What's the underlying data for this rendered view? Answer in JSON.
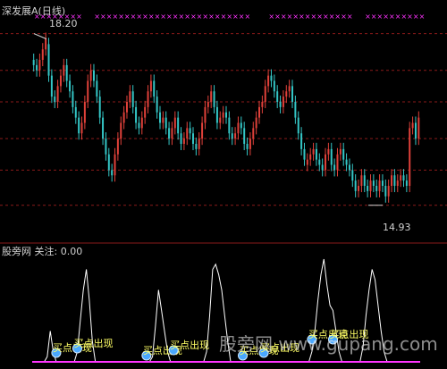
{
  "top_panel": {
    "title": "深发展A(日线)",
    "high_label": "18.20",
    "low_label": "14.93"
  },
  "bottom_panel": {
    "title": "股旁网 关注: 0.00",
    "signals": [
      {
        "label": "买点出现",
        "ref": 0
      },
      {
        "label": "买点出现",
        "ref": 1
      },
      {
        "label": "买点出现",
        "ref": 2
      },
      {
        "label": "买点出现",
        "ref": 3
      },
      {
        "label": "买点出现",
        "ref": 4
      },
      {
        "label": "买点出现",
        "ref": 5
      },
      {
        "label": "买点出现",
        "ref": 6
      },
      {
        "label": "买点出现",
        "ref": 7
      }
    ]
  },
  "watermark": "股旁网 www.gupang.com",
  "colors": {
    "up": "#e0413a",
    "down": "#34c6c6",
    "grid": "#8a1a1a",
    "title": "#d0d0d0",
    "price_label": "#d0d0d0",
    "oscillator": "#ffffff",
    "marker": "#ff33ff",
    "signal_text": "#ffff66",
    "ball": "#4aa8ff"
  },
  "chart_data": [
    {
      "type": "candlestick",
      "title": "深发展A(日线)",
      "ylim": [
        14.5,
        18.5
      ],
      "annotations": [
        {
          "text": "18.20",
          "value": 18.2
        },
        {
          "text": "14.93",
          "value": 14.93
        }
      ],
      "close": [
        17.6,
        17.5,
        17.7,
        17.9,
        18.1,
        17.4,
        17.0,
        16.9,
        17.2,
        17.4,
        17.6,
        17.3,
        17.1,
        16.8,
        16.6,
        16.3,
        16.5,
        16.9,
        17.3,
        17.5,
        17.3,
        17.0,
        16.6,
        16.2,
        15.9,
        15.6,
        15.5,
        15.9,
        16.2,
        16.5,
        16.7,
        16.9,
        17.1,
        16.8,
        16.5,
        16.4,
        16.6,
        16.8,
        17.1,
        17.3,
        17.0,
        16.7,
        16.5,
        16.6,
        16.4,
        16.2,
        16.4,
        16.6,
        16.3,
        16.1,
        16.2,
        16.4,
        16.3,
        16.1,
        16.0,
        16.2,
        16.5,
        16.8,
        16.9,
        17.1,
        16.8,
        16.5,
        16.6,
        16.7,
        16.6,
        16.3,
        16.2,
        16.3,
        16.5,
        16.4,
        16.1,
        16.0,
        16.2,
        16.4,
        16.6,
        16.8,
        16.9,
        17.2,
        17.4,
        17.3,
        17.1,
        16.9,
        16.8,
        17.0,
        17.1,
        17.2,
        16.9,
        16.6,
        16.3,
        16.0,
        15.8,
        15.8,
        15.9,
        16.0,
        15.8,
        15.7,
        15.6,
        15.9,
        16.0,
        15.7,
        15.6,
        15.9,
        16.0,
        15.8,
        15.7,
        15.6,
        15.4,
        15.2,
        15.3,
        15.5,
        15.3,
        15.2,
        15.4,
        15.3,
        15.2,
        15.4,
        15.3,
        15.1,
        15.3,
        15.5,
        15.3,
        15.4,
        15.5,
        15.4,
        15.3,
        16.4,
        16.5,
        16.2,
        16.6
      ],
      "open": [
        17.7,
        17.6,
        17.5,
        17.7,
        17.9,
        18.0,
        17.4,
        17.0,
        16.9,
        17.2,
        17.4,
        17.6,
        17.3,
        17.1,
        16.8,
        16.6,
        16.3,
        16.5,
        16.9,
        17.3,
        17.5,
        17.3,
        17.0,
        16.6,
        16.2,
        15.9,
        15.6,
        15.5,
        15.9,
        16.2,
        16.5,
        16.7,
        16.9,
        17.1,
        16.8,
        16.5,
        16.4,
        16.6,
        16.8,
        17.1,
        17.3,
        17.0,
        16.7,
        16.5,
        16.6,
        16.4,
        16.2,
        16.4,
        16.6,
        16.3,
        16.1,
        16.2,
        16.4,
        16.3,
        16.1,
        16.0,
        16.2,
        16.5,
        16.8,
        16.9,
        17.1,
        16.8,
        16.5,
        16.6,
        16.7,
        16.6,
        16.3,
        16.2,
        16.3,
        16.5,
        16.4,
        16.1,
        16.0,
        16.2,
        16.4,
        16.6,
        16.8,
        16.9,
        17.2,
        17.4,
        17.3,
        17.1,
        16.9,
        16.8,
        17.0,
        17.1,
        17.2,
        16.9,
        16.6,
        16.3,
        16.0,
        15.7,
        15.8,
        15.9,
        16.0,
        15.8,
        15.7,
        15.6,
        15.9,
        16.0,
        15.7,
        15.6,
        15.9,
        16.0,
        15.8,
        15.7,
        15.6,
        15.4,
        15.2,
        15.3,
        15.5,
        15.3,
        15.2,
        15.4,
        15.3,
        15.2,
        15.4,
        15.3,
        15.1,
        15.3,
        15.5,
        15.3,
        15.4,
        15.5,
        15.4,
        15.3,
        16.4,
        16.5,
        16.2
      ],
      "oscillator": [
        0,
        0,
        0,
        0,
        0,
        0.05,
        0.3,
        0.1,
        0,
        0,
        0,
        0,
        0,
        0,
        0,
        0.1,
        0.4,
        0.7,
        0.9,
        0.6,
        0.2,
        0,
        0,
        0,
        0,
        0,
        0,
        0,
        0,
        0,
        0,
        0,
        0,
        0,
        0,
        0,
        0,
        0,
        0,
        0,
        0.05,
        0.35,
        0.7,
        0.5,
        0.3,
        0.1,
        0,
        0,
        0,
        0,
        0,
        0,
        0,
        0,
        0,
        0,
        0,
        0,
        0.1,
        0.45,
        0.9,
        0.95,
        0.85,
        0.7,
        0.45,
        0.2,
        0,
        0,
        0,
        0,
        0,
        0,
        0,
        0,
        0,
        0,
        0,
        0,
        0,
        0,
        0,
        0,
        0,
        0,
        0,
        0,
        0,
        0,
        0,
        0,
        0,
        0,
        0,
        0,
        0,
        0,
        0,
        0,
        0,
        0,
        0,
        0,
        0,
        0,
        0,
        0,
        0,
        0,
        0,
        0,
        0,
        0,
        0,
        0,
        0,
        0,
        0,
        0,
        0,
        0,
        0,
        0,
        0,
        0,
        0,
        0,
        0
      ],
      "oscillator_top": [
        0,
        0,
        0,
        0,
        0,
        0,
        0,
        0,
        0,
        0,
        0,
        0,
        0,
        0,
        0,
        0,
        0,
        0,
        0,
        0,
        0,
        0,
        0,
        0,
        0,
        0,
        0,
        0,
        0,
        0,
        0,
        0,
        0,
        0,
        0,
        0,
        0,
        0,
        0,
        0,
        0,
        0,
        0,
        0,
        0,
        0,
        0,
        0,
        0,
        0,
        0,
        0,
        0,
        0,
        0,
        0,
        0,
        0,
        0,
        0,
        0,
        0,
        0,
        0,
        0,
        0,
        0,
        0,
        0,
        0,
        0,
        0,
        0,
        0,
        0,
        0,
        0,
        0,
        0,
        0,
        0,
        0,
        0,
        0,
        0,
        0,
        0,
        0,
        0,
        0,
        0,
        0,
        0,
        0.1,
        0.3,
        0.6,
        0.85,
        1.0,
        0.75,
        0.55,
        0.5,
        0.3,
        0.1,
        0,
        0,
        0,
        0,
        0,
        0,
        0,
        0.15,
        0.45,
        0.7,
        0.9,
        0.8,
        0.55,
        0.3,
        0.1,
        0,
        0,
        0,
        0,
        0,
        0,
        0,
        0,
        0,
        0,
        0
      ]
    }
  ]
}
